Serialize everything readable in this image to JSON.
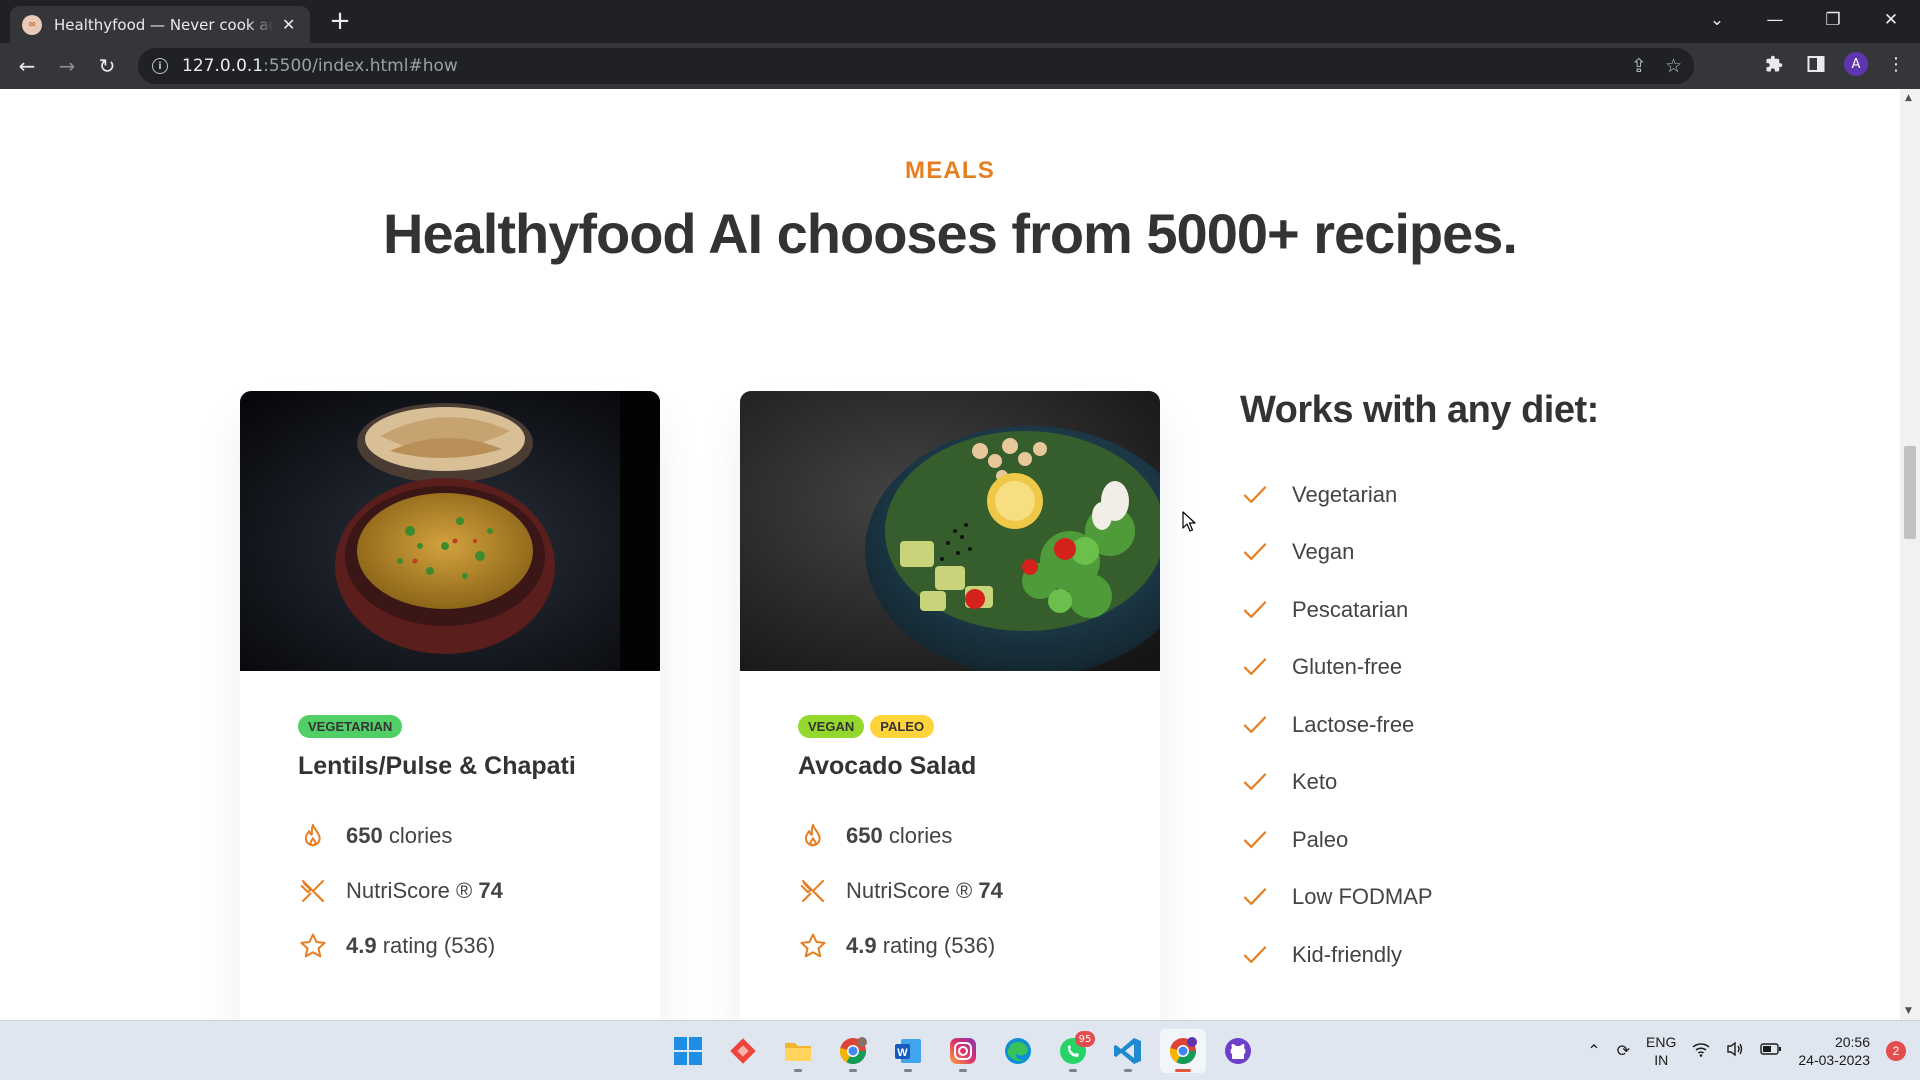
{
  "browser": {
    "tab_title": "Healthyfood — Never cook again!",
    "tab_favicon": "∞",
    "url_host": "127.0.0.1",
    "url_path": ":5500/index.html#how",
    "profile_initial": "A"
  },
  "section": {
    "subheading": "MEALS",
    "heading": "Healthyfood AI chooses from 5000+ recipes."
  },
  "meals": [
    {
      "tags": [
        "VEGETARIAN"
      ],
      "title": "Lentils/Pulse & Chapati",
      "calories_value": "650",
      "calories_label": "clories",
      "nutri_label": "NutriScore ®",
      "nutri_value": "74",
      "rating_value": "4.9",
      "rating_label": "rating (536)"
    },
    {
      "tags": [
        "VEGAN",
        "PALEO"
      ],
      "title": "Avocado Salad",
      "calories_value": "650",
      "calories_label": "clories",
      "nutri_label": "NutriScore ®",
      "nutri_value": "74",
      "rating_value": "4.9",
      "rating_label": "rating (536)"
    }
  ],
  "diets": {
    "title": "Works with any diet:",
    "items": [
      "Vegetarian",
      "Vegan",
      "Pescatarian",
      "Gluten-free",
      "Lactose-free",
      "Keto",
      "Paleo",
      "Low FODMAP",
      "Kid-friendly"
    ]
  },
  "taskbar": {
    "apps": [
      "windows-start",
      "anydesk",
      "file-explorer",
      "chrome-profile",
      "word",
      "instagram",
      "edge",
      "whatsapp",
      "vscode",
      "chrome",
      "github"
    ],
    "whatsapp_badge": "95",
    "lang_line1": "ENG",
    "lang_line2": "IN",
    "time": "20:56",
    "date": "24-03-2023",
    "notifications": "2"
  },
  "colors": {
    "accent": "#e67e22",
    "heading": "#333333",
    "tag_vegetarian": "#51cf66",
    "tag_vegan": "#94d82d",
    "tag_paleo": "#ffd43b"
  }
}
